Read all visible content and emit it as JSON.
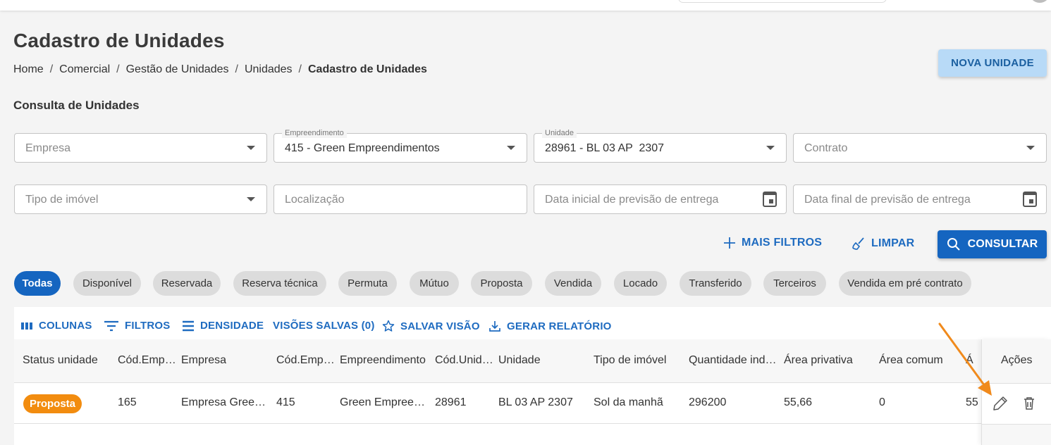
{
  "header": {
    "title": "Cadastro de Unidades",
    "new_button": "NOVA UNIDADE"
  },
  "breadcrumb": [
    "Home",
    "Comercial",
    "Gestão de Unidades",
    "Unidades",
    "Cadastro de Unidades"
  ],
  "filters": {
    "section_title": "Consulta de Unidades",
    "empresa": {
      "placeholder": "Empresa"
    },
    "empreendimento": {
      "label": "Empreendimento",
      "value": "415 - Green Empreendimentos"
    },
    "unidade": {
      "label": "Unidade",
      "value": "28961 - BL 03 AP  2307"
    },
    "contrato": {
      "placeholder": "Contrato"
    },
    "tipo_imovel": {
      "placeholder": "Tipo de imóvel"
    },
    "localizacao": {
      "placeholder": "Localização"
    },
    "data_inicial": {
      "placeholder": "Data inicial de previsão de entrega"
    },
    "data_final": {
      "placeholder": "Data final de previsão de entrega"
    }
  },
  "actions": {
    "mais_filtros": "MAIS FILTROS",
    "limpar": "LIMPAR",
    "consultar": "CONSULTAR"
  },
  "status_chips": [
    "Todas",
    "Disponível",
    "Reservada",
    "Reserva técnica",
    "Permuta",
    "Mútuo",
    "Proposta",
    "Vendida",
    "Locado",
    "Transferido",
    "Terceiros",
    "Vendida em pré contrato"
  ],
  "grid_toolbar": {
    "colunas": "COLUNAS",
    "filtros": "FILTROS",
    "densidade": "DENSIDADE",
    "visoes_salvas": "VISÕES SALVAS (0)",
    "salvar_visao": "SALVAR VISÃO",
    "gerar_relatorio": "GERAR RELATÓRIO"
  },
  "table": {
    "columns": [
      "Status unidade",
      "Cód.Emp…",
      "Empresa",
      "Cód.Emp…",
      "Empreendimento",
      "Cód.Unid…",
      "Unidade",
      "Tipo de imóvel",
      "Quantidade ind…",
      "Área privativa",
      "Área comum",
      "Á"
    ],
    "actions_header": "Ações",
    "rows": [
      [
        "Proposta",
        "165",
        "Empresa Gree…",
        "415",
        "Green Empree…",
        "28961",
        "BL 03 AP 2307",
        "Sol da manhã",
        "296200",
        "55,66",
        "0",
        "55"
      ]
    ]
  },
  "colors": {
    "primary": "#1565c0",
    "status_proposta": "#f28c0f",
    "annotation_arrow": "#f08a1c"
  }
}
